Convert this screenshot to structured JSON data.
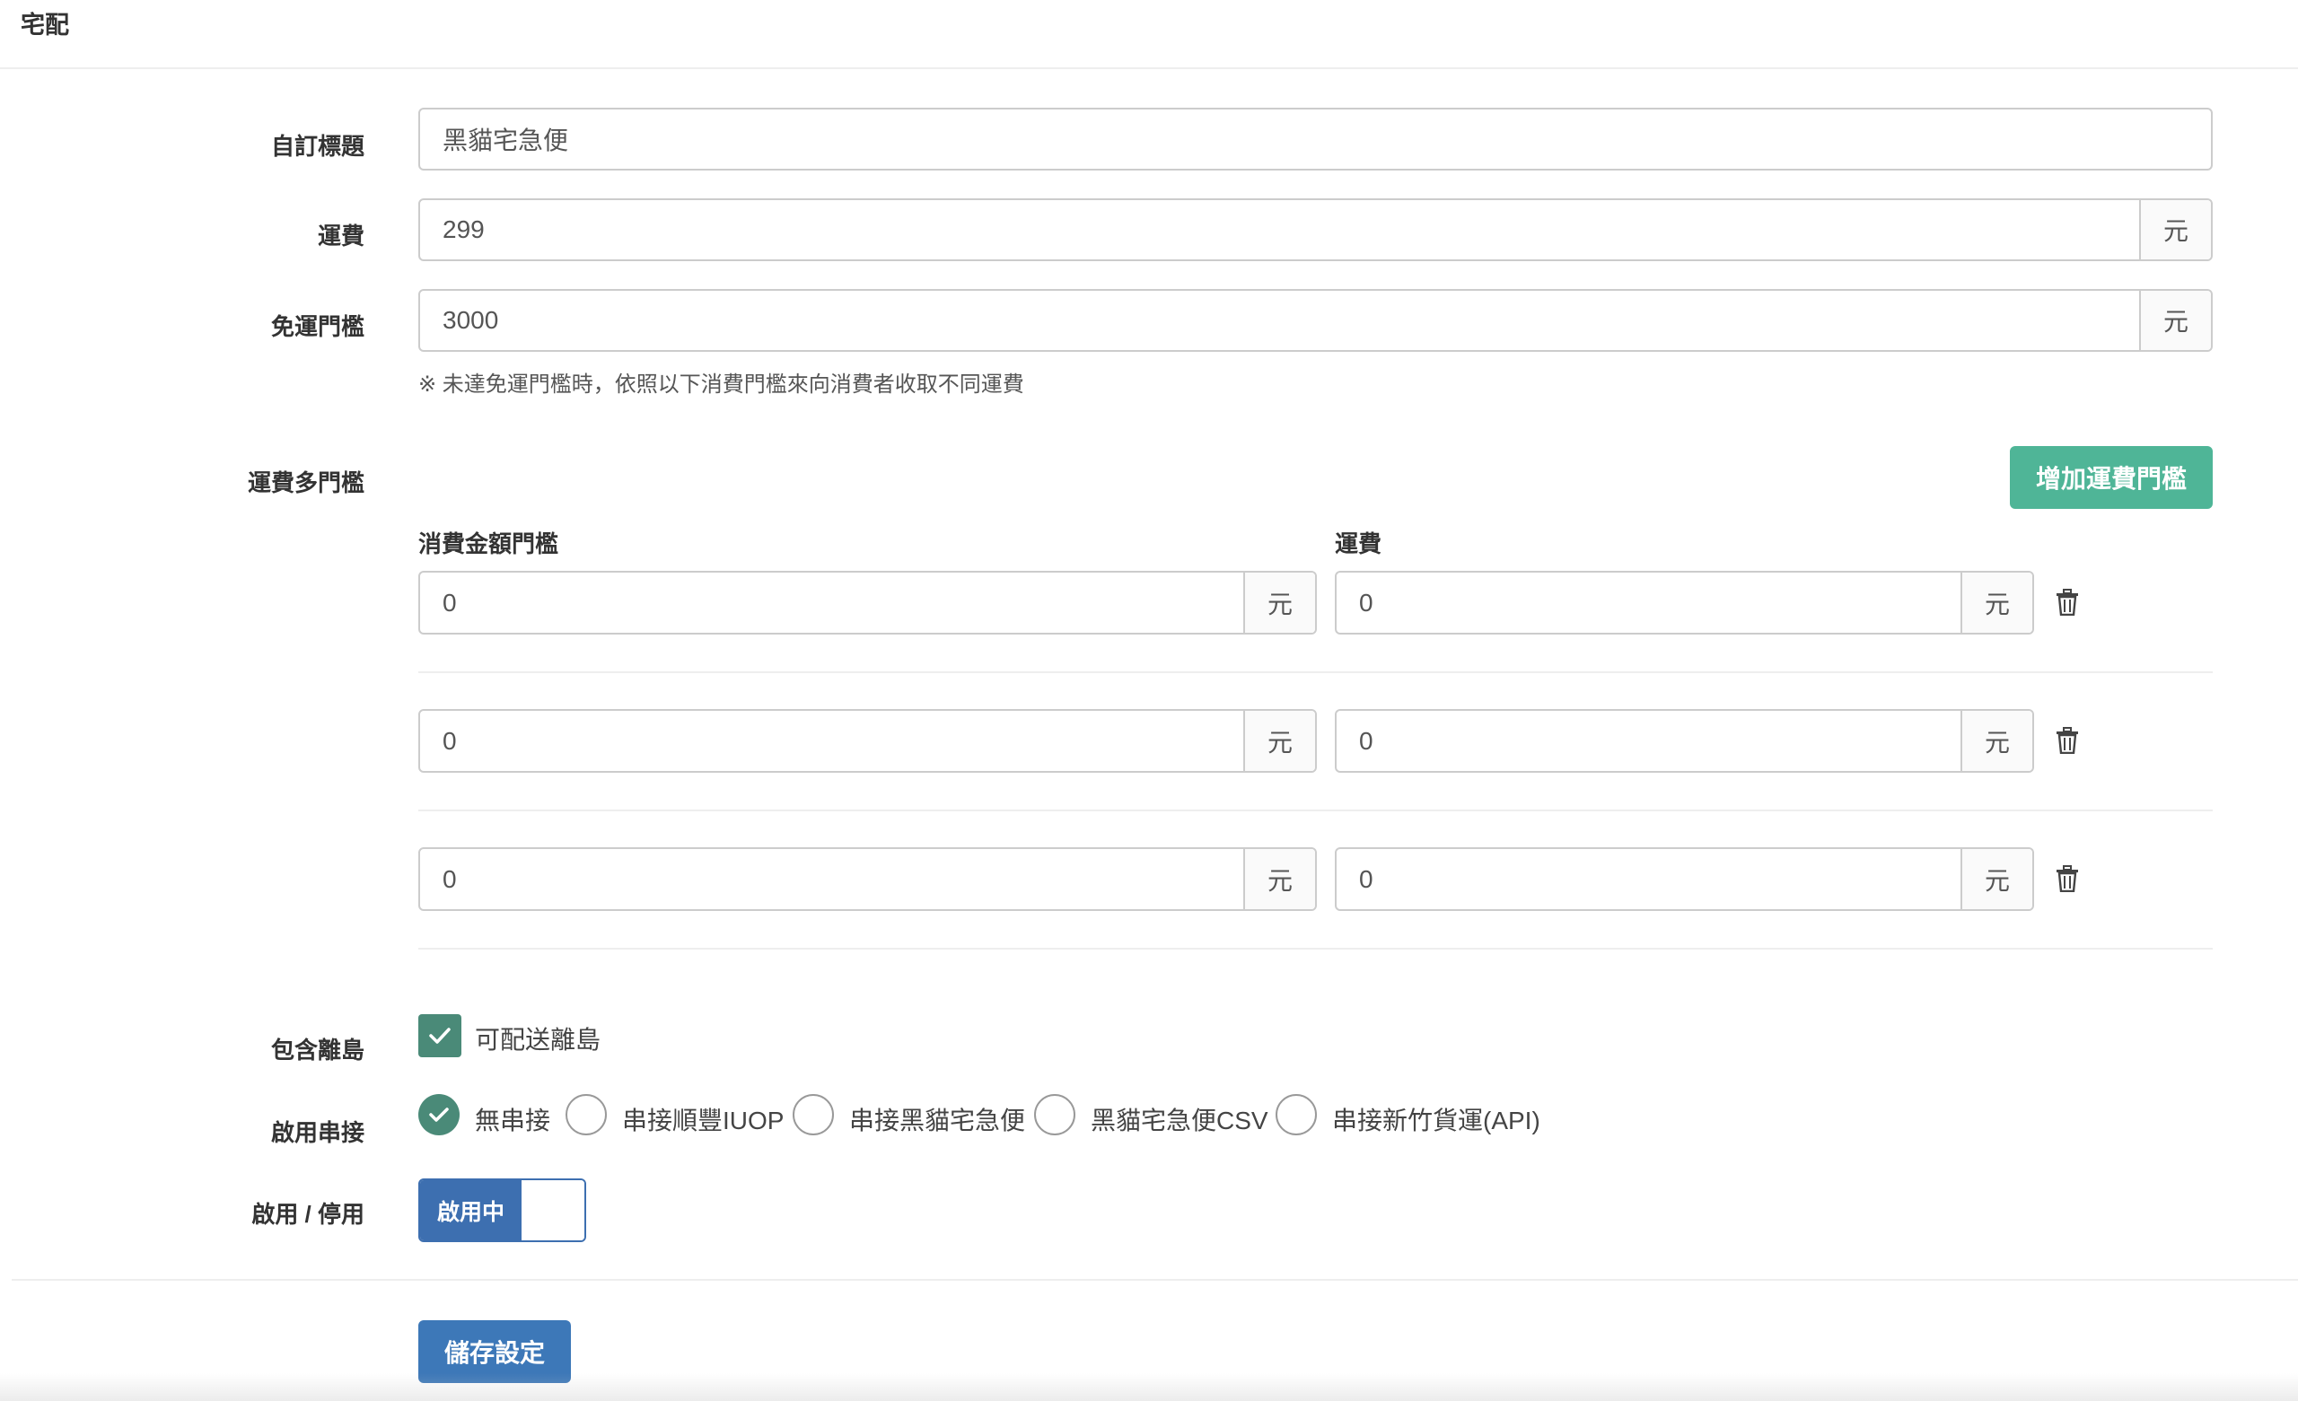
{
  "page": {
    "title": "宅配"
  },
  "form": {
    "custom_title": {
      "label": "自訂標題",
      "value": "黑貓宅急便"
    },
    "shipping_fee": {
      "label": "運費",
      "value": "299",
      "unit": "元"
    },
    "free_threshold": {
      "label": "免運門檻",
      "value": "3000",
      "unit": "元"
    },
    "hint": "※ 未達免運門檻時，依照以下消費門檻來向消費者收取不同運費"
  },
  "tiers": {
    "label": "運費多門檻",
    "add_button": "增加運費門檻",
    "col_amount": "消費金額門檻",
    "col_fee": "運費",
    "rows": [
      {
        "amount": "0",
        "amount_unit": "元",
        "fee": "0",
        "fee_unit": "元"
      },
      {
        "amount": "0",
        "amount_unit": "元",
        "fee": "0",
        "fee_unit": "元"
      },
      {
        "amount": "0",
        "amount_unit": "元",
        "fee": "0",
        "fee_unit": "元"
      }
    ]
  },
  "islands": {
    "label": "包含離島",
    "checkbox_label": "可配送離島",
    "checked": true
  },
  "integration": {
    "label": "啟用串接",
    "options": [
      "無串接",
      "串接順豐IUOP",
      "串接黑貓宅急便",
      "黑貓宅急便CSV",
      "串接新竹貨運(API)"
    ],
    "selected": "無串接"
  },
  "status": {
    "label": "啟用 / 停用",
    "toggle_text": "啟用中"
  },
  "save_button": "儲存設定",
  "colors": {
    "green": "#4fb597",
    "check_green": "#4a8a78",
    "blue": "#3d78b8"
  },
  "icons": {
    "trash": "trash-icon",
    "check": "check-icon"
  }
}
